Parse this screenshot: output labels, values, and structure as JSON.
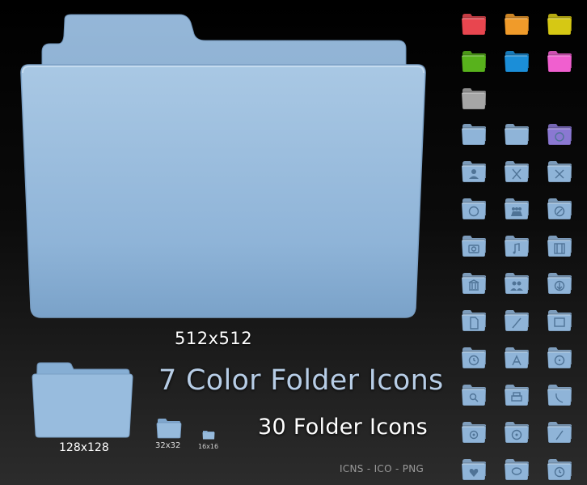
{
  "sizes": {
    "large": "512x512",
    "medium": "128x128",
    "small": "32x32",
    "tiny": "16x16"
  },
  "headline": "7 Color Folder Icons",
  "subline": "30 Folder Icons",
  "formats": "ICNS - ICO - PNG",
  "color_folders": [
    {
      "name": "red-folder-icon",
      "color": "#e8464f"
    },
    {
      "name": "orange-folder-icon",
      "color": "#f09b2a"
    },
    {
      "name": "yellow-folder-icon",
      "color": "#d6c814"
    },
    {
      "name": "green-folder-icon",
      "color": "#58b21c"
    },
    {
      "name": "blue-folder-icon",
      "color": "#1b8ed8"
    },
    {
      "name": "pink-folder-icon",
      "color": "#f05fcf"
    },
    {
      "name": "gray-folder-icon",
      "color": "#a6a6a6"
    }
  ],
  "base_folder_color": "#8fb4d8",
  "folder_icons": [
    "plain-folder-icon",
    "open-folder-icon",
    "system-preferences-folder-icon",
    "user-folder-icon",
    "applications-folder-icon",
    "utilities-folder-icon",
    "globe-folder-icon",
    "group-folder-icon",
    "safari-folder-icon",
    "camera-folder-icon",
    "music-folder-icon",
    "movies-folder-icon",
    "library-folder-icon",
    "users-folder-icon",
    "downloads-folder-icon",
    "documents-folder-icon",
    "developer-folder-icon",
    "desktop-folder-icon",
    "clock-folder-icon",
    "app-store-folder-icon",
    "radiation-folder-icon",
    "search-folder-icon",
    "print-folder-icon",
    "phone-folder-icon",
    "mail-folder-icon",
    "burn-folder-icon",
    "pen-folder-icon",
    "favorites-folder-icon",
    "chat-folder-icon",
    "time-machine-folder-icon"
  ]
}
